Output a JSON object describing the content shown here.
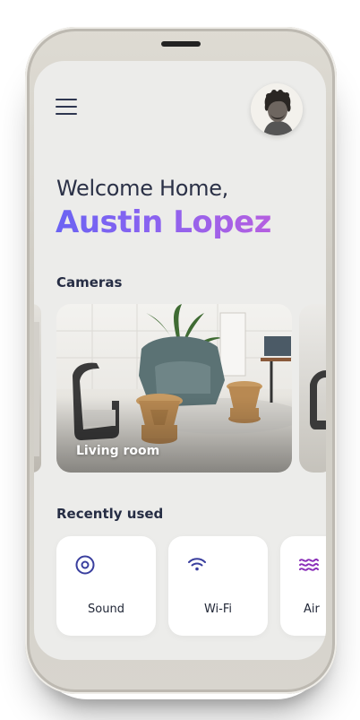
{
  "header": {
    "menu_icon": "hamburger-menu-icon",
    "avatar": "user-avatar"
  },
  "greeting": {
    "welcome": "Welcome Home,",
    "name": "Austin Lopez"
  },
  "cameras": {
    "title": "Cameras",
    "items": [
      {
        "label": "Living room"
      }
    ]
  },
  "recent": {
    "title": "Recently used",
    "items": [
      {
        "label": "Sound",
        "icon": "sound-icon"
      },
      {
        "label": "Wi-Fi",
        "icon": "wifi-icon"
      },
      {
        "label": "Air",
        "icon": "air-icon"
      }
    ]
  },
  "colors": {
    "accent_start": "#6b63f3",
    "accent_end": "#b55fe0",
    "text_dark": "#2b3147",
    "icon_blue": "#3a3f9e",
    "icon_purple": "#8a2fb8"
  }
}
